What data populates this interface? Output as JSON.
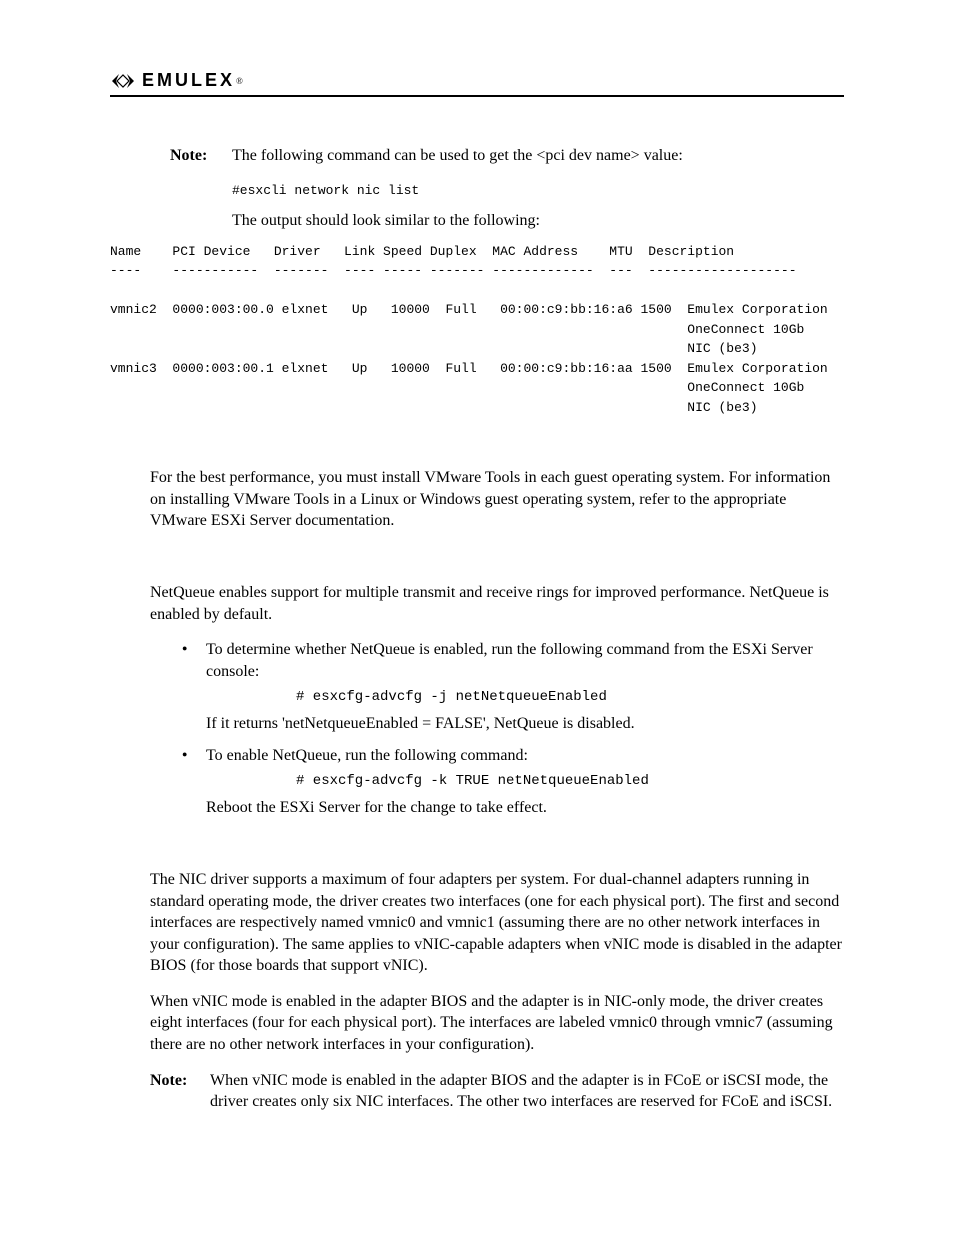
{
  "brand": "EMULEX",
  "note1_label": "Note:",
  "note1_text": "The following command can be used to get the <pci dev name> value:",
  "note1_cmd": "#esxcli network nic list",
  "note1_followup": "The output should look similar to the following:",
  "table_text": "Name    PCI Device   Driver   Link Speed Duplex  MAC Address    MTU  Description\n----    -----------  -------  ---- ----- ------- -------------  ---  -------------------\n\nvmnic2  0000:003:00.0 elxnet   Up   10000  Full   00:00:c9:bb:16:a6 1500  Emulex Corporation\n                                                                          OneConnect 10Gb\n                                                                          NIC (be3)\nvmnic3  0000:003:00.1 elxnet   Up   10000  Full   00:00:c9:bb:16:aa 1500  Emulex Corporation\n                                                                          OneConnect 10Gb\n                                                                          NIC (be3)",
  "vmtools_para": "For the best performance, you must install VMware Tools in each guest operating system. For information on installing VMware Tools in a Linux or Windows guest operating system, refer to the appropriate VMware ESXi Server documentation.",
  "netqueue_para": "NetQueue enables support for multiple transmit and receive rings for improved performance. NetQueue is enabled by default.",
  "bullets": {
    "b1_lead": "To determine whether NetQueue is enabled, run the following command from the ESXi Server console:",
    "b1_cmd": "# esxcfg-advcfg -j netNetqueueEnabled",
    "b1_follow": "If it returns 'netNetqueueEnabled = FALSE', NetQueue is disabled.",
    "b2_lead": "To enable NetQueue, run the following command:",
    "b2_cmd": "# esxcfg-advcfg -k TRUE netNetqueueEnabled",
    "b2_follow": "Reboot the ESXi Server for the change to take effect."
  },
  "nic_para1": "The NIC driver supports a maximum of four adapters per system. For dual-channel adapters running in standard operating mode, the driver creates two interfaces (one for each physical port). The first and second interfaces are respectively named vmnic0 and vmnic1 (assuming there are no other network interfaces in your configuration). The same applies to vNIC-capable adapters when vNIC mode is disabled in the adapter BIOS (for those boards that support vNIC).",
  "nic_para2": "When vNIC mode is enabled in the adapter BIOS and the adapter is in NIC-only mode, the driver creates eight interfaces (four for each physical port). The interfaces are labeled vmnic0 through vmnic7 (assuming there are no other network interfaces in your configuration).",
  "note2_label": "Note:",
  "note2_text": "When vNIC mode is enabled in the adapter BIOS and the adapter is in FCoE or iSCSI mode, the driver creates only six NIC interfaces. The other two interfaces are reserved for FCoE and iSCSI."
}
